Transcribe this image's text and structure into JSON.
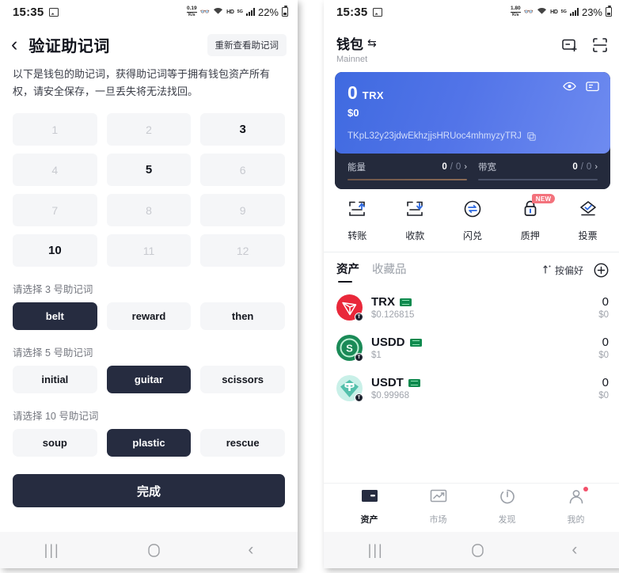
{
  "left_phone": {
    "status_bar": {
      "time": "15:35",
      "data_rate_value": "0.19",
      "data_rate_unit": "K/s",
      "hd_label": "HD",
      "signal_sup": "5G",
      "battery_percent": "22%"
    },
    "header": {
      "back_icon": "chevron-left-icon",
      "title": "验证助记词",
      "reshow_button": "重新查看助记词"
    },
    "description": "以下是钱包的助记词，获得助记词等于拥有钱包资产所有权，请安全保存，一旦丢失将无法找回。",
    "number_grid": [
      {
        "n": "1",
        "active": false
      },
      {
        "n": "2",
        "active": false
      },
      {
        "n": "3",
        "active": true
      },
      {
        "n": "4",
        "active": false
      },
      {
        "n": "5",
        "active": true
      },
      {
        "n": "6",
        "active": false
      },
      {
        "n": "7",
        "active": false
      },
      {
        "n": "8",
        "active": false
      },
      {
        "n": "9",
        "active": false
      },
      {
        "n": "10",
        "active": true
      },
      {
        "n": "11",
        "active": false
      },
      {
        "n": "12",
        "active": false
      }
    ],
    "selections": [
      {
        "label": "请选择 3 号助记词",
        "words": [
          {
            "w": "belt",
            "selected": true
          },
          {
            "w": "reward",
            "selected": false
          },
          {
            "w": "then",
            "selected": false
          }
        ]
      },
      {
        "label": "请选择 5 号助记词",
        "words": [
          {
            "w": "initial",
            "selected": false
          },
          {
            "w": "guitar",
            "selected": true
          },
          {
            "w": "scissors",
            "selected": false
          }
        ]
      },
      {
        "label": "请选择 10 号助记词",
        "words": [
          {
            "w": "soup",
            "selected": false
          },
          {
            "w": "plastic",
            "selected": true
          },
          {
            "w": "rescue",
            "selected": false
          }
        ]
      }
    ],
    "finish_button": "完成",
    "nav_bar": {
      "recents": "|||",
      "home": "home-icon",
      "back": "back-icon"
    }
  },
  "right_phone": {
    "status_bar": {
      "time": "15:35",
      "data_rate_value": "1.80",
      "data_rate_unit": "K/s",
      "hd_label": "HD",
      "signal_sup": "5G",
      "battery_percent": "23%"
    },
    "header": {
      "wallet_name": "钱包",
      "switch_glyph": "⇆",
      "network": "Mainnet",
      "add_wallet_icon": "add-wallet-icon",
      "scan_icon": "scan-qr-icon"
    },
    "balance_card": {
      "amount": "0",
      "symbol": "TRX",
      "fiat": "$0",
      "address": "TKpL32y23jdwEkhzjjsHRUoc4mhmyzyTRJ",
      "eye_icon": "eye-icon",
      "card_icon": "wallet-card-icon",
      "copy_icon": "copy-icon"
    },
    "resources": [
      {
        "name": "能量",
        "used": "0",
        "total": "0",
        "accent": "#8a6a55"
      },
      {
        "name": "带宽",
        "used": "0",
        "total": "0",
        "accent": "#4a5168"
      }
    ],
    "actions": [
      {
        "label": "转账",
        "icon": "send-icon",
        "badge": ""
      },
      {
        "label": "收款",
        "icon": "receive-icon",
        "badge": ""
      },
      {
        "label": "闪兑",
        "icon": "swap-icon",
        "badge": ""
      },
      {
        "label": "质押",
        "icon": "stake-lock-icon",
        "badge": "NEW"
      },
      {
        "label": "投票",
        "icon": "vote-icon",
        "badge": ""
      }
    ],
    "asset_tabs": [
      {
        "label": "资产",
        "active": true
      },
      {
        "label": "收藏品",
        "active": false
      }
    ],
    "sort_label": "按偏好",
    "sort_icon": "sort-icon",
    "add_token_icon": "plus-circle-icon",
    "tokens": [
      {
        "symbol": "TRX",
        "price": "$0.126815",
        "balance": "0",
        "fiat": "$0",
        "icon_color": "#e9283a",
        "icon_glyph": "trx-logo-icon"
      },
      {
        "symbol": "USDD",
        "price": "$1",
        "balance": "0",
        "fiat": "$0",
        "icon_color": "#1a8a57",
        "icon_glyph": "usdd-logo-icon"
      },
      {
        "symbol": "USDT",
        "price": "$0.99968",
        "balance": "0",
        "fiat": "$0",
        "icon_color": "#53c0ab",
        "icon_glyph": "usdt-logo-icon"
      }
    ],
    "bottom_nav": [
      {
        "label": "资产",
        "icon": "wallet-icon",
        "active": true,
        "dot": false
      },
      {
        "label": "市场",
        "icon": "market-chart-icon",
        "active": false,
        "dot": false
      },
      {
        "label": "发现",
        "icon": "discover-icon",
        "active": false,
        "dot": false
      },
      {
        "label": "我的",
        "icon": "profile-icon",
        "active": false,
        "dot": true
      }
    ],
    "nav_bar": {
      "recents": "|||",
      "home": "home-icon",
      "back": "back-icon"
    }
  }
}
